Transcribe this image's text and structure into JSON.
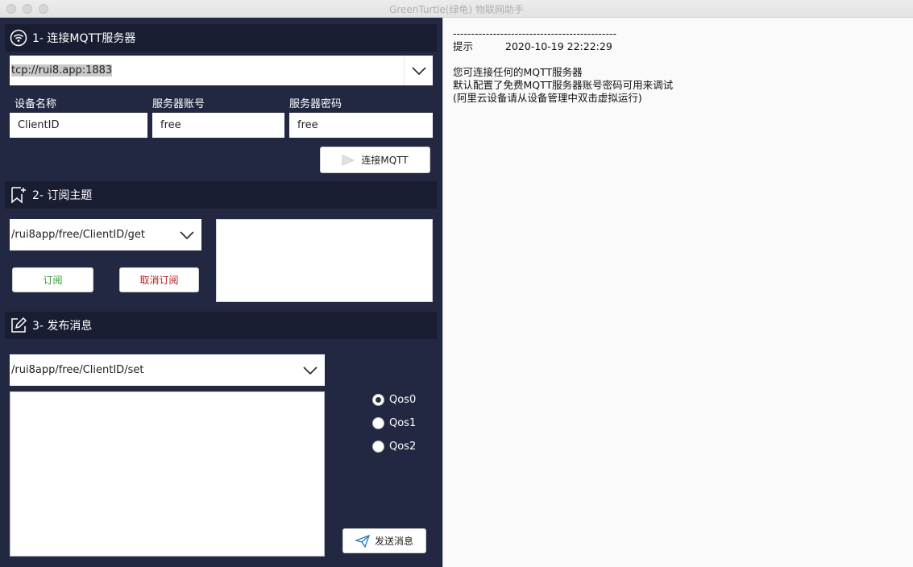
{
  "window": {
    "title": "GreenTurtle(绿龟) 物联网助手"
  },
  "connect": {
    "heading": "1- 连接MQTT服务器",
    "server_url": "tcp://rui8.app:1883",
    "device_label": "设备名称",
    "account_label": "服务器账号",
    "password_label": "服务器密码",
    "device_value": "ClientID",
    "account_value": "free",
    "password_value": "free",
    "connect_button": "连接MQTT"
  },
  "subscribe": {
    "heading": "2- 订阅主题",
    "topic": "/rui8app/free/ClientID/get",
    "subscribe_button": "订阅",
    "unsubscribe_button": "取消订阅"
  },
  "publish": {
    "heading": "3- 发布消息",
    "topic": "/rui8app/free/ClientID/set",
    "qos_options": [
      "Qos0",
      "Qos1",
      "Qos2"
    ],
    "qos_selected": "Qos0",
    "send_button": "发送消息"
  },
  "log": {
    "separator": "---------------------------------------------",
    "entry_tag": "提示",
    "entry_time": "2020-10-19 22:22:29",
    "lines": [
      "您可连接任何的MQTT服务器",
      "默认配置了免费MQTT服务器账号密码可用来调试",
      "(阿里云设备请从设备管理中双击虚拟运行)"
    ]
  },
  "colors": {
    "panel_bg": "#222841",
    "section_bg": "#191d32",
    "subscribe_green": "#2e9a2e",
    "unsubscribe_red": "#b02020"
  }
}
